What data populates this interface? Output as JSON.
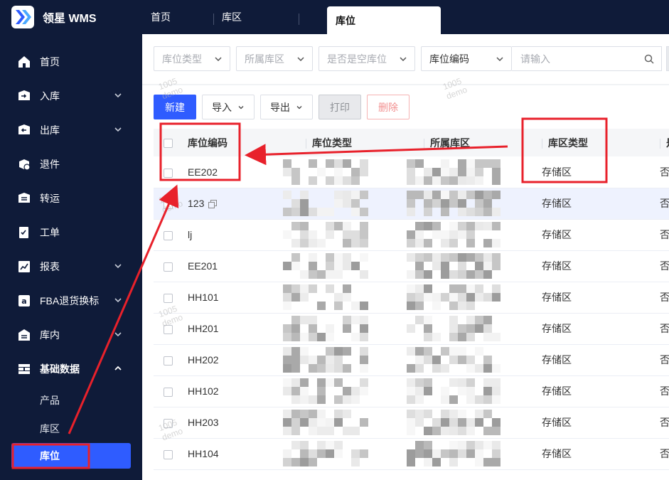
{
  "app": {
    "title": "领星 WMS"
  },
  "tabs": [
    {
      "label": "首页"
    },
    {
      "label": "库区"
    },
    {
      "label": "库位"
    }
  ],
  "sidebar": {
    "items": [
      {
        "label": "首页",
        "icon": "home-icon"
      },
      {
        "label": "入库",
        "icon": "inbound-icon"
      },
      {
        "label": "出库",
        "icon": "outbound-icon"
      },
      {
        "label": "退件",
        "icon": "return-icon"
      },
      {
        "label": "转运",
        "icon": "transfer-icon"
      },
      {
        "label": "工单",
        "icon": "workorder-icon"
      },
      {
        "label": "报表",
        "icon": "report-icon"
      },
      {
        "label": "FBA退货换标",
        "icon": "amazon-icon"
      },
      {
        "label": "库内",
        "icon": "warehouse-icon"
      },
      {
        "label": "基础数据",
        "icon": "basedata-icon"
      }
    ],
    "sub_items": [
      {
        "label": "产品"
      },
      {
        "label": "库区"
      },
      {
        "label": "库位"
      }
    ]
  },
  "filters": {
    "location_type": "库位类型",
    "zone": "所属库区",
    "is_empty": "是否是空库位",
    "search_field": "库位编码",
    "search_placeholder": "请输入"
  },
  "toolbar": {
    "new": "新建",
    "import": "导入",
    "export": "导出",
    "print": "打印",
    "delete": "删除"
  },
  "table": {
    "headers": {
      "code": "库位编码",
      "type": "库位类型",
      "zone": "所属库区",
      "zone_type": "库区类型",
      "empty": "是"
    },
    "rows": [
      {
        "code": "EE202",
        "zone_type": "存储区",
        "empty": "否"
      },
      {
        "code": "123",
        "zone_type": "存储区",
        "empty": "否"
      },
      {
        "code": "lj",
        "zone_type": "存储区",
        "empty": "否"
      },
      {
        "code": "EE201",
        "zone_type": "存储区",
        "empty": "否"
      },
      {
        "code": "HH101",
        "zone_type": "存储区",
        "empty": "否"
      },
      {
        "code": "HH201",
        "zone_type": "存储区",
        "empty": "否"
      },
      {
        "code": "HH202",
        "zone_type": "存储区",
        "empty": "否"
      },
      {
        "code": "HH102",
        "zone_type": "存储区",
        "empty": "否"
      },
      {
        "code": "HH203",
        "zone_type": "存储区",
        "empty": "否"
      },
      {
        "code": "HH104",
        "zone_type": "存储区",
        "empty": "否"
      }
    ]
  },
  "watermark": {
    "line1": "1005",
    "line2": "demo"
  },
  "colors": {
    "sidebar_bg": "#0f1b39",
    "primary": "#2f5cff",
    "annotation": "#e8212b"
  }
}
